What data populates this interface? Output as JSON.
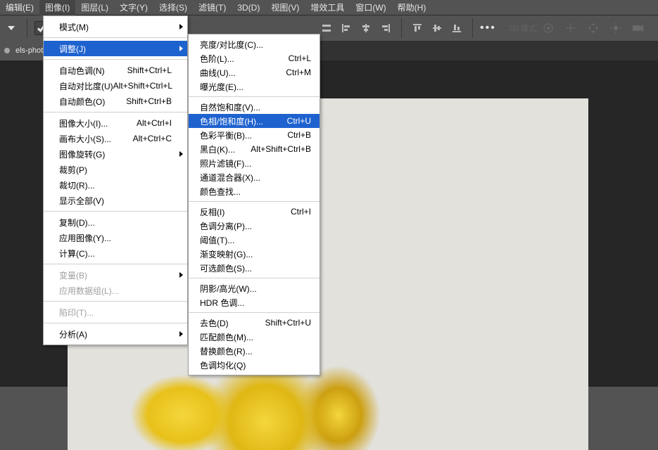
{
  "menubar": [
    "编辑(E)",
    "图像(I)",
    "图层(L)",
    "文字(Y)",
    "选择(S)",
    "滤镜(T)",
    "3D(D)",
    "视图(V)",
    "增效工具",
    "窗口(W)",
    "帮助(H)"
  ],
  "menubar_active_index": 1,
  "toolbar": {
    "d3_label": "3D 模式:"
  },
  "tabstrip": {
    "tab_label": "els-photo-"
  },
  "image_menu": {
    "groups": [
      {
        "items": [
          {
            "label": "模式(M)",
            "has_submenu": true
          }
        ]
      },
      {
        "items": [
          {
            "label": "调整(J)",
            "has_submenu": true,
            "hl": true
          }
        ]
      },
      {
        "items": [
          {
            "label": "自动色调(N)",
            "shortcut": "Shift+Ctrl+L"
          },
          {
            "label": "自动对比度(U)",
            "shortcut": "Alt+Shift+Ctrl+L"
          },
          {
            "label": "自动颜色(O)",
            "shortcut": "Shift+Ctrl+B"
          }
        ]
      },
      {
        "items": [
          {
            "label": "图像大小(I)...",
            "shortcut": "Alt+Ctrl+I"
          },
          {
            "label": "画布大小(S)...",
            "shortcut": "Alt+Ctrl+C"
          },
          {
            "label": "图像旋转(G)",
            "has_submenu": true
          },
          {
            "label": "裁剪(P)"
          },
          {
            "label": "裁切(R)..."
          },
          {
            "label": "显示全部(V)"
          }
        ]
      },
      {
        "items": [
          {
            "label": "复制(D)..."
          },
          {
            "label": "应用图像(Y)..."
          },
          {
            "label": "计算(C)..."
          }
        ]
      },
      {
        "items": [
          {
            "label": "变量(B)",
            "has_submenu": true,
            "disabled": true
          },
          {
            "label": "应用数据组(L)...",
            "disabled": true
          }
        ]
      },
      {
        "items": [
          {
            "label": "陷印(T)...",
            "disabled": true
          }
        ]
      },
      {
        "items": [
          {
            "label": "分析(A)",
            "has_submenu": true
          }
        ]
      }
    ]
  },
  "adjust_submenu": {
    "groups": [
      {
        "items": [
          {
            "label": "亮度/对比度(C)..."
          },
          {
            "label": "色阶(L)...",
            "shortcut": "Ctrl+L"
          },
          {
            "label": "曲线(U)...",
            "shortcut": "Ctrl+M"
          },
          {
            "label": "曝光度(E)..."
          }
        ]
      },
      {
        "items": [
          {
            "label": "自然饱和度(V)..."
          },
          {
            "label": "色相/饱和度(H)...",
            "shortcut": "Ctrl+U",
            "hl": true
          },
          {
            "label": "色彩平衡(B)...",
            "shortcut": "Ctrl+B"
          },
          {
            "label": "黑白(K)...",
            "shortcut": "Alt+Shift+Ctrl+B"
          },
          {
            "label": "照片滤镜(F)..."
          },
          {
            "label": "通道混合器(X)..."
          },
          {
            "label": "颜色查找..."
          }
        ]
      },
      {
        "items": [
          {
            "label": "反相(I)",
            "shortcut": "Ctrl+I"
          },
          {
            "label": "色调分离(P)..."
          },
          {
            "label": "阈值(T)..."
          },
          {
            "label": "渐变映射(G)..."
          },
          {
            "label": "可选颜色(S)..."
          }
        ]
      },
      {
        "items": [
          {
            "label": "阴影/高光(W)..."
          },
          {
            "label": "HDR 色调..."
          }
        ]
      },
      {
        "items": [
          {
            "label": "去色(D)",
            "shortcut": "Shift+Ctrl+U"
          },
          {
            "label": "匹配颜色(M)..."
          },
          {
            "label": "替换颜色(R)..."
          },
          {
            "label": "色调均化(Q)"
          }
        ]
      }
    ]
  }
}
